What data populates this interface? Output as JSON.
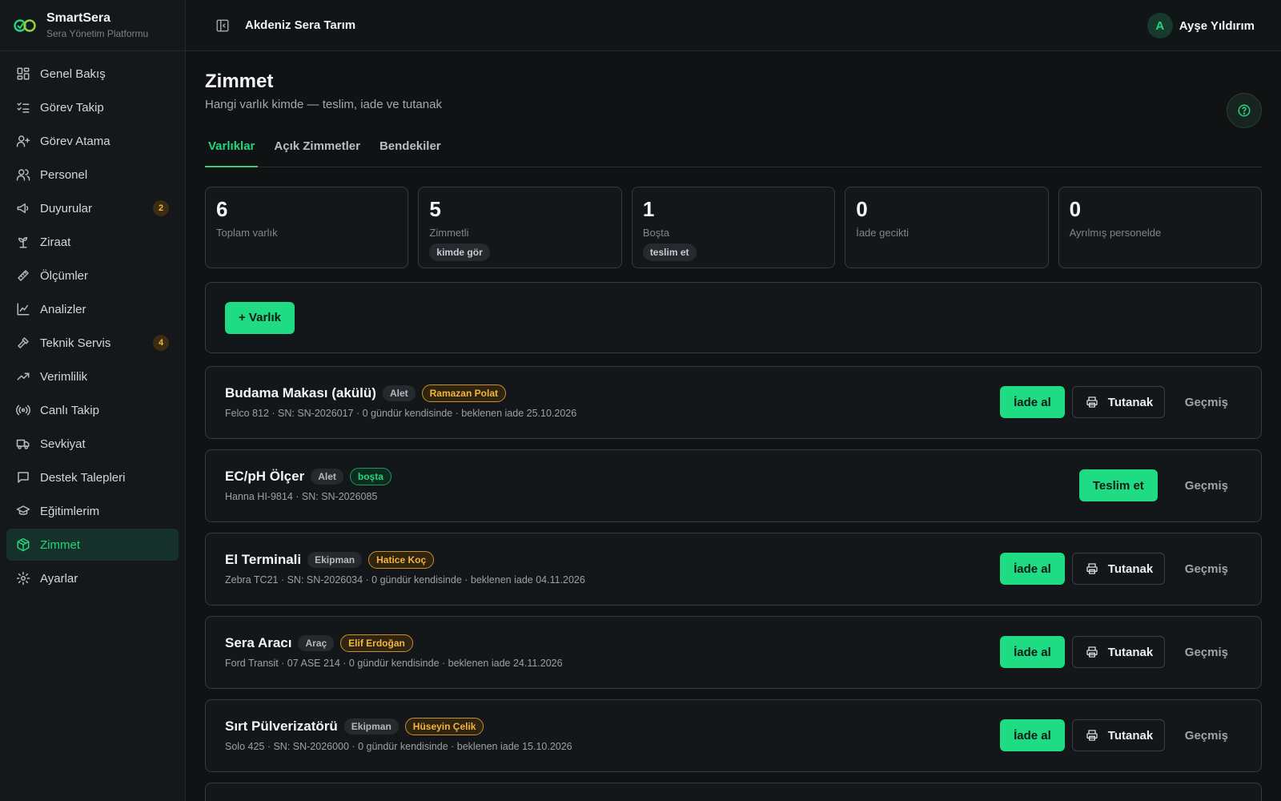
{
  "brand": {
    "name": "SmartSera",
    "subtitle": "Sera Yönetim Platformu",
    "accent": "#22d67e"
  },
  "sidebar": {
    "items": [
      {
        "label": "Genel Bakış",
        "icon": "dashboard-icon"
      },
      {
        "label": "Görev Takip",
        "icon": "checklist-icon"
      },
      {
        "label": "Görev Atama",
        "icon": "user-plus-icon"
      },
      {
        "label": "Personel",
        "icon": "users-icon"
      },
      {
        "label": "Duyurular",
        "icon": "megaphone-icon",
        "badge": "2"
      },
      {
        "label": "Ziraat",
        "icon": "sprout-icon"
      },
      {
        "label": "Ölçümler",
        "icon": "ruler-icon"
      },
      {
        "label": "Analizler",
        "icon": "line-chart-icon"
      },
      {
        "label": "Teknik Servis",
        "icon": "hammer-icon",
        "badge": "4"
      },
      {
        "label": "Verimlilik",
        "icon": "trending-up-icon"
      },
      {
        "label": "Canlı Takip",
        "icon": "radio-icon"
      },
      {
        "label": "Sevkiyat",
        "icon": "truck-icon"
      },
      {
        "label": "Destek Talepleri",
        "icon": "message-square-icon"
      },
      {
        "label": "Eğitimlerim",
        "icon": "graduation-cap-icon"
      },
      {
        "label": "Zimmet",
        "icon": "package-icon",
        "active": true
      },
      {
        "label": "Ayarlar",
        "icon": "gear-icon"
      }
    ]
  },
  "topbar": {
    "org": "Akdeniz Sera Tarım",
    "user_initial": "A",
    "user_name": "Ayşe Yıldırım"
  },
  "page": {
    "title": "Zimmet",
    "subtitle": "Hangi varlık kimde — teslim, iade ve tutanak",
    "tabs": [
      "Varlıklar",
      "Açık Zimmetler",
      "Bendekiler"
    ],
    "active_tab": "Varlıklar"
  },
  "stats": [
    {
      "value": "6",
      "label": "Toplam varlık"
    },
    {
      "value": "5",
      "label": "Zimmetli",
      "chip": "kimde gör"
    },
    {
      "value": "1",
      "label": "Boşta",
      "chip": "teslim et"
    },
    {
      "value": "0",
      "label": "İade gecikti"
    },
    {
      "value": "0",
      "label": "Ayrılmış personelde"
    }
  ],
  "add_button": "+ Varlık",
  "actions": {
    "return": "İade al",
    "deliver": "Teslim et",
    "report": "Tutanak",
    "history": "Geçmiş"
  },
  "assets": [
    {
      "name": "Budama Makası (akülü)",
      "type": "Alet",
      "holder": "Ramazan Polat",
      "meta": "Felco 812 · SN: SN-2026017 · 0 gündür kendisinde · beklenen iade 25.10.2026"
    },
    {
      "name": "EC/pH Ölçer",
      "type": "Alet",
      "status": "boşta",
      "meta": "Hanna HI-9814 · SN: SN-2026085"
    },
    {
      "name": "El Terminali",
      "type": "Ekipman",
      "holder": "Hatice Koç",
      "meta": "Zebra TC21 · SN: SN-2026034 · 0 gündür kendisinde · beklenen iade 04.11.2026"
    },
    {
      "name": "Sera Aracı",
      "type": "Araç",
      "holder": "Elif Erdoğan",
      "meta": "Ford Transit · 07 ASE 214 · 0 gündür kendisinde · beklenen iade 24.11.2026"
    },
    {
      "name": "Sırt Pülverizatörü",
      "type": "Ekipman",
      "holder": "Hüseyin Çelik",
      "meta": "Solo 425 · SN: SN-2026000 · 0 gündür kendisinde · beklenen iade 15.10.2026"
    }
  ]
}
